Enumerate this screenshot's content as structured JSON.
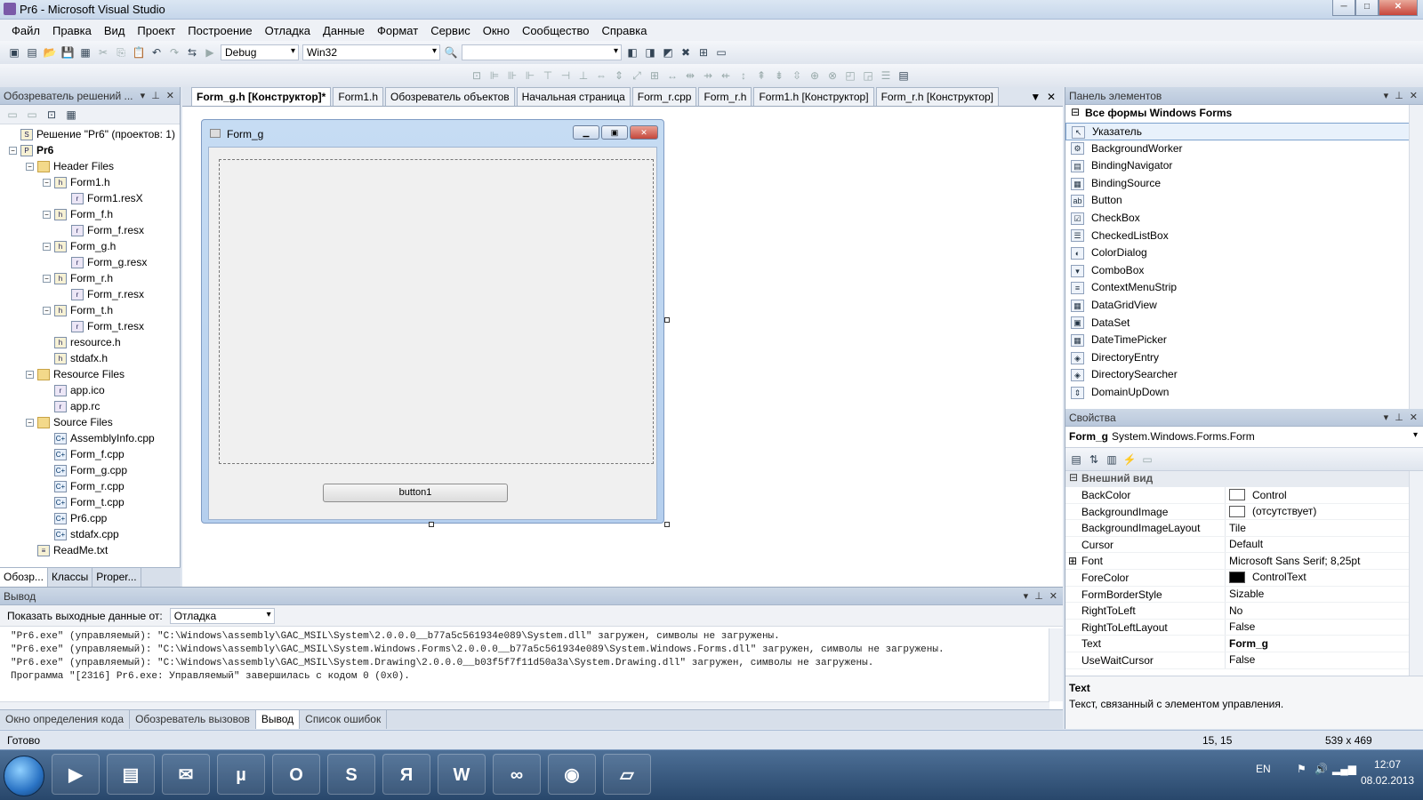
{
  "window": {
    "title": "Pr6 - Microsoft Visual Studio",
    "buttons": [
      "─",
      "□",
      "✕"
    ]
  },
  "menu": [
    "Файл",
    "Правка",
    "Вид",
    "Проект",
    "Построение",
    "Отладка",
    "Данные",
    "Формат",
    "Сервис",
    "Окно",
    "Сообщество",
    "Справка"
  ],
  "toolbar": {
    "config": "Debug",
    "platform": "Win32"
  },
  "solution_explorer": {
    "title": "Обозреватель решений ...",
    "tree": [
      {
        "label": "Решение \"Pr6\"  (проектов: 1)",
        "level": 0,
        "kind": "solution"
      },
      {
        "label": "Pr6",
        "level": 0,
        "kind": "project",
        "bold": true
      },
      {
        "label": "Header Files",
        "level": 1,
        "kind": "folder"
      },
      {
        "label": "Form1.h",
        "level": 2,
        "kind": "h"
      },
      {
        "label": "Form1.resX",
        "level": 3,
        "kind": "res"
      },
      {
        "label": "Form_f.h",
        "level": 2,
        "kind": "h"
      },
      {
        "label": "Form_f.resx",
        "level": 3,
        "kind": "res"
      },
      {
        "label": "Form_g.h",
        "level": 2,
        "kind": "h"
      },
      {
        "label": "Form_g.resx",
        "level": 3,
        "kind": "res"
      },
      {
        "label": "Form_r.h",
        "level": 2,
        "kind": "h"
      },
      {
        "label": "Form_r.resx",
        "level": 3,
        "kind": "res"
      },
      {
        "label": "Form_t.h",
        "level": 2,
        "kind": "h"
      },
      {
        "label": "Form_t.resx",
        "level": 3,
        "kind": "res"
      },
      {
        "label": "resource.h",
        "level": 2,
        "kind": "h"
      },
      {
        "label": "stdafx.h",
        "level": 2,
        "kind": "h"
      },
      {
        "label": "Resource Files",
        "level": 1,
        "kind": "folder"
      },
      {
        "label": "app.ico",
        "level": 2,
        "kind": "res"
      },
      {
        "label": "app.rc",
        "level": 2,
        "kind": "res"
      },
      {
        "label": "Source Files",
        "level": 1,
        "kind": "folder"
      },
      {
        "label": "AssemblyInfo.cpp",
        "level": 2,
        "kind": "cpp"
      },
      {
        "label": "Form_f.cpp",
        "level": 2,
        "kind": "cpp"
      },
      {
        "label": "Form_g.cpp",
        "level": 2,
        "kind": "cpp"
      },
      {
        "label": "Form_r.cpp",
        "level": 2,
        "kind": "cpp"
      },
      {
        "label": "Form_t.cpp",
        "level": 2,
        "kind": "cpp"
      },
      {
        "label": "Pr6.cpp",
        "level": 2,
        "kind": "cpp"
      },
      {
        "label": "stdafx.cpp",
        "level": 2,
        "kind": "cpp"
      },
      {
        "label": "ReadMe.txt",
        "level": 1,
        "kind": "txt"
      }
    ],
    "tabs": [
      "Обозр...",
      "Классы",
      "Proper..."
    ]
  },
  "doc_tabs": [
    "Form_g.h [Конструктор]*",
    "Form1.h",
    "Обозреватель объектов",
    "Начальная страница",
    "Form_r.cpp",
    "Form_r.h",
    "Form1.h [Конструктор]",
    "Form_r.h [Конструктор]"
  ],
  "designer": {
    "form_title": "Form_g",
    "button_text": "button1"
  },
  "toolbox": {
    "title": "Панель элементов",
    "group": "Все формы Windows Forms",
    "items": [
      "Указатель",
      "BackgroundWorker",
      "BindingNavigator",
      "BindingSource",
      "Button",
      "CheckBox",
      "CheckedListBox",
      "ColorDialog",
      "ComboBox",
      "ContextMenuStrip",
      "DataGridView",
      "DataSet",
      "DateTimePicker",
      "DirectoryEntry",
      "DirectorySearcher",
      "DomainUpDown"
    ]
  },
  "properties": {
    "title": "Свойства",
    "object_name": "Form_g",
    "object_type": "System.Windows.Forms.Form",
    "category": "Внешний вид",
    "rows": [
      {
        "name": "BackColor",
        "value": "Control",
        "swatch": "#ffffff"
      },
      {
        "name": "BackgroundImage",
        "value": "(отсутствует)",
        "swatch": "#ffffff"
      },
      {
        "name": "BackgroundImageLayout",
        "value": "Tile"
      },
      {
        "name": "Cursor",
        "value": "Default"
      },
      {
        "name": "Font",
        "value": "Microsoft Sans Serif; 8,25pt",
        "expandable": true
      },
      {
        "name": "ForeColor",
        "value": "ControlText",
        "swatch": "#000000"
      },
      {
        "name": "FormBorderStyle",
        "value": "Sizable"
      },
      {
        "name": "RightToLeft",
        "value": "No"
      },
      {
        "name": "RightToLeftLayout",
        "value": "False"
      },
      {
        "name": "Text",
        "value": "Form_g",
        "bold": true
      },
      {
        "name": "UseWaitCursor",
        "value": "False"
      }
    ],
    "desc_title": "Text",
    "desc_text": "Текст, связанный с элементом управления."
  },
  "output": {
    "title": "Вывод",
    "show_label": "Показать выходные данные от:",
    "source": "Отладка",
    "lines": [
      "\"Pr6.exe\" (управляемый): \"C:\\Windows\\assembly\\GAC_MSIL\\System\\2.0.0.0__b77a5c561934e089\\System.dll\" загружен, символы не загружены.",
      "\"Pr6.exe\" (управляемый): \"C:\\Windows\\assembly\\GAC_MSIL\\System.Windows.Forms\\2.0.0.0__b77a5c561934e089\\System.Windows.Forms.dll\" загружен, символы не загружены.",
      "\"Pr6.exe\" (управляемый): \"C:\\Windows\\assembly\\GAC_MSIL\\System.Drawing\\2.0.0.0__b03f5f7f11d50a3a\\System.Drawing.dll\" загружен, символы не загружены.",
      "Программа \"[2316] Pr6.exe: Управляемый\" завершилась с кодом 0 (0x0)."
    ],
    "tabs": [
      "Окно определения кода",
      "Обозреватель вызовов",
      "Вывод",
      "Список ошибок"
    ]
  },
  "status": {
    "text": "Готово",
    "position": "15, 15",
    "size": "539 x 469"
  },
  "taskbar": {
    "lang": "EN",
    "time": "12:07",
    "date": "08.02.2013"
  }
}
